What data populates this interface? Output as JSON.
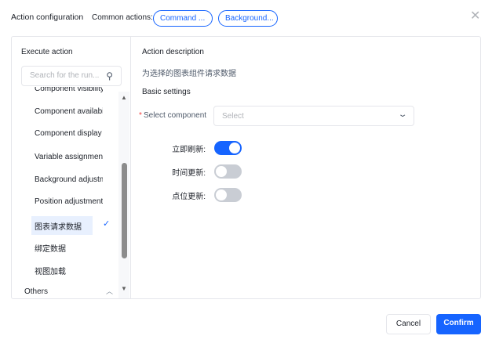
{
  "header": {
    "title": "Action configuration",
    "common_label": "Common actions:",
    "common_actions": [
      "Command ...",
      "Background..."
    ]
  },
  "left": {
    "heading": "Execute action",
    "search_placeholder": "Search for the run...",
    "items": [
      "Component visibility",
      "Component availabil",
      "Component display s",
      "Variable assignment",
      "Background adjustm",
      "Position adjustment",
      "图表请求数据",
      "绑定数据",
      "视图加载"
    ],
    "group": "Others"
  },
  "right": {
    "desc_heading": "Action description",
    "desc": "为选择的图表组件请求数据",
    "basic": "Basic settings",
    "select_label": "Select component",
    "select_placeholder": "Select",
    "toggles": [
      {
        "label": "立即刷新:",
        "on": true
      },
      {
        "label": "时间更新:",
        "on": false
      },
      {
        "label": "点位更新:",
        "on": false
      }
    ]
  },
  "footer": {
    "cancel": "Cancel",
    "confirm": "Confirm"
  },
  "colors": {
    "primary": "#1664ff"
  }
}
